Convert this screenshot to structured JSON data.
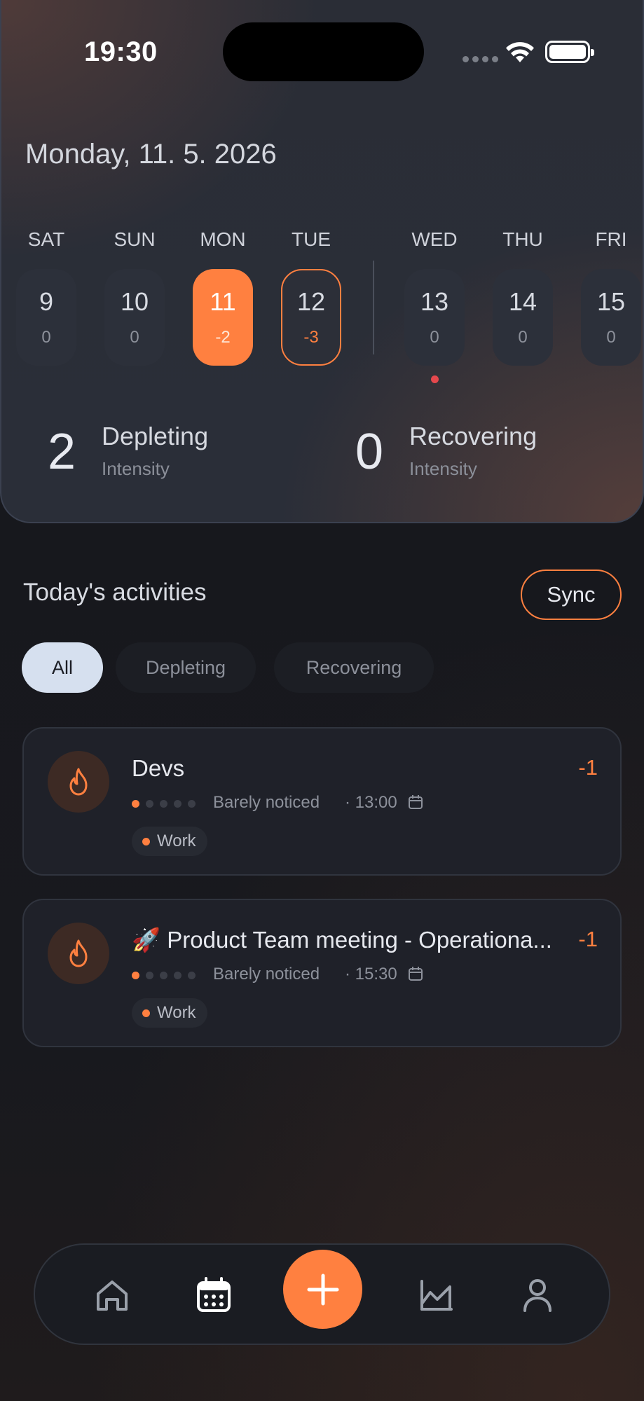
{
  "status_bar": {
    "time": "19:30"
  },
  "header": {
    "date": "Monday, 11. 5. 2026",
    "days": [
      {
        "name": "SAT",
        "num": "9",
        "value": "0"
      },
      {
        "name": "SUN",
        "num": "10",
        "value": "0"
      },
      {
        "name": "MON",
        "num": "11",
        "value": "-2",
        "state": "selected"
      },
      {
        "name": "TUE",
        "num": "12",
        "value": "-3",
        "state": "outlined"
      },
      {
        "name": "WED",
        "num": "13",
        "value": "0"
      },
      {
        "name": "THU",
        "num": "14",
        "value": "0"
      },
      {
        "name": "FRI",
        "num": "15",
        "value": "0"
      }
    ],
    "stats": {
      "depleting": {
        "value": "2",
        "label": "Depleting",
        "sub": "Intensity"
      },
      "recovering": {
        "value": "0",
        "label": "Recovering",
        "sub": "Intensity"
      }
    }
  },
  "activities": {
    "title": "Today's activities",
    "sync_label": "Sync",
    "filters": [
      "All",
      "Depleting",
      "Recovering"
    ],
    "active_filter": "All",
    "items": [
      {
        "title": "Devs",
        "score": "-1",
        "intensity_label": "Barely noticed",
        "intensity_level": 1,
        "time": "· 13:00",
        "tag": "Work",
        "icon": "flame-icon"
      },
      {
        "title": "🚀 Product Team meeting - Operationa...",
        "score": "-1",
        "intensity_label": "Barely noticed",
        "intensity_level": 1,
        "time": "· 15:30",
        "tag": "Work",
        "icon": "flame-icon"
      }
    ]
  },
  "nav": {
    "items": [
      "home-icon",
      "calendar-icon",
      "add-icon",
      "chart-icon",
      "profile-icon"
    ],
    "active": "calendar-icon"
  },
  "colors": {
    "accent": "#ff8040",
    "background": "#17181d",
    "card": "#1f2129"
  }
}
